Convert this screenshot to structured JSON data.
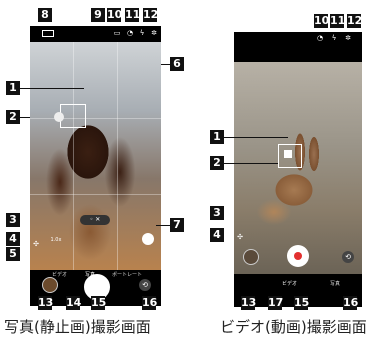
{
  "captions": {
    "photo": "写真(静止画)撮影画面",
    "video": "ビデオ(動画)撮影画面"
  },
  "photo_screen": {
    "zoom_label": "1.0x",
    "mode_labels": [
      "ビデオ",
      "写真",
      "ポートレート"
    ],
    "callouts": [
      "8",
      "9",
      "10",
      "11",
      "12",
      "1",
      "2",
      "6",
      "3",
      "4",
      "5",
      "7",
      "13",
      "14",
      "15",
      "16"
    ]
  },
  "video_screen": {
    "mode_labels": [
      "ビデオ",
      "写真"
    ],
    "callouts": [
      "10",
      "11",
      "12",
      "1",
      "2",
      "3",
      "4",
      "13",
      "17",
      "15",
      "16"
    ]
  },
  "colors": {
    "record": "#e3302f",
    "callout_bg": "#111111"
  }
}
